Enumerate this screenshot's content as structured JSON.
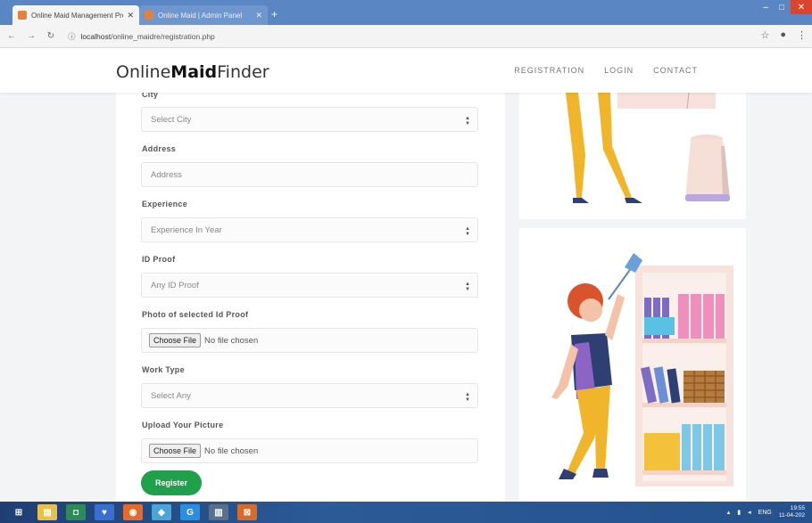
{
  "browser": {
    "tabs": [
      {
        "label": "Online Maid Management Proje",
        "active": true
      },
      {
        "label": "Online Maid | Admin Panel",
        "active": false
      }
    ],
    "url_prefix": "localhost",
    "url_path": "/online_maidre/registration.php"
  },
  "site": {
    "brand_light": "Online",
    "brand_bold": "Maid",
    "brand_tail": "Finder",
    "menu": [
      "REGISTRATION",
      "LOGIN",
      "CONTACT"
    ]
  },
  "form": {
    "fields": [
      {
        "label": "City",
        "type": "select",
        "value": "Select City"
      },
      {
        "label": "Address",
        "type": "text",
        "placeholder": "Address"
      },
      {
        "label": "Experience",
        "type": "select",
        "value": "Experience In Year"
      },
      {
        "label": "ID Proof",
        "type": "select",
        "value": "Any ID Proof"
      },
      {
        "label": "Photo of selected Id Proof",
        "type": "file",
        "button": "Choose File",
        "status": "No file chosen"
      },
      {
        "label": "Work Type",
        "type": "select",
        "value": "Select Any"
      },
      {
        "label": "Upload Your Picture",
        "type": "file",
        "button": "Choose File",
        "status": "No file chosen"
      }
    ],
    "submit": "Register"
  },
  "taskbar": {
    "lang": "ENG",
    "time": "19:55",
    "date": "11-04-202"
  },
  "colors": {
    "accent_green": "#21a04c",
    "titlebar_blue": "#5b86c4"
  }
}
